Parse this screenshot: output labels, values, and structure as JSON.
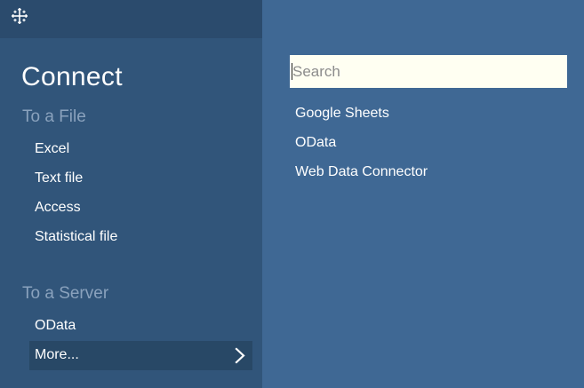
{
  "sidebar": {
    "logo_icon": "tableau-plus-logo-icon",
    "title": "Connect",
    "file_section": {
      "heading": "To a File",
      "items": [
        "Excel",
        "Text file",
        "Access",
        "Statistical file"
      ]
    },
    "server_section": {
      "heading": "To a Server",
      "items": [
        "OData"
      ],
      "more_label": "More...",
      "more_icon": "chevron-right-icon"
    }
  },
  "main": {
    "search": {
      "placeholder": "Search",
      "value": ""
    },
    "connectors": [
      "Google Sheets",
      "OData",
      "Web Data Connector"
    ]
  },
  "colors": {
    "main_background": "#3f6894",
    "sidebar_background": "#31557a",
    "sidebar_header": "#2b4b6d",
    "more_row_background": "#284866",
    "search_background": "#fffff2",
    "section_heading": "#8aa2bd"
  }
}
